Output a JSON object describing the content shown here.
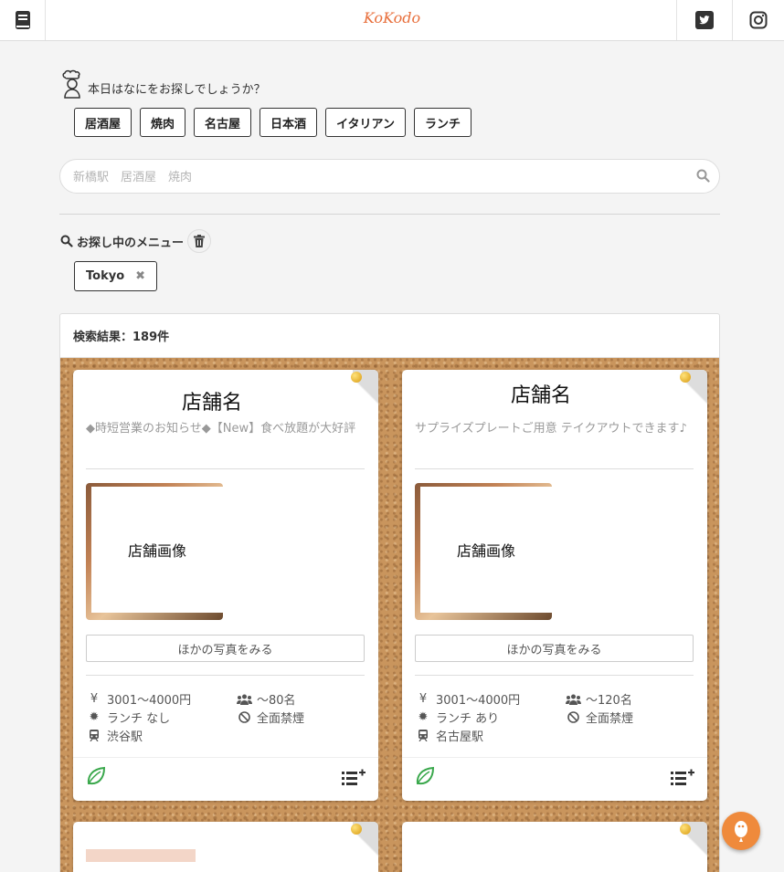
{
  "header": {
    "logo": "KoKodo",
    "menu_icon": "book-icon",
    "twitter_icon": "twitter-icon",
    "instagram_icon": "instagram-icon"
  },
  "prompt": {
    "text": "本日はなにをお探しでしょうか？",
    "icon": "chef-icon"
  },
  "chips": [
    "居酒屋",
    "焼肉",
    "名古屋",
    "日本酒",
    "イタリアン",
    "ランチ"
  ],
  "search": {
    "placeholder": "新橋駅　居酒屋　焼肉",
    "value": ""
  },
  "filter": {
    "title": "お探し中のメニュー",
    "tags": [
      "Tokyo"
    ]
  },
  "results": {
    "label": "検索結果：189件",
    "cards": [
      {
        "name": "店舗名",
        "description": "◆時短営業のお知らせ◆【New】食べ放題が大好評",
        "image_label": "店舗画像",
        "more_photos": "ほかの写真をみる",
        "price": "3001〜4000円",
        "capacity": "〜80名",
        "lunch": "ランチ なし",
        "smoking": "全面禁煙",
        "station": "渋谷駅"
      },
      {
        "name": "店舗名",
        "description": "サプライズプレートご用意 テイクアウトできます♪",
        "image_label": "店舗画像",
        "more_photos": "ほかの写真をみる",
        "price": "3001〜4000円",
        "capacity": "〜120名",
        "lunch": "ランチ あり",
        "smoking": "全面禁煙",
        "station": "名古屋駅"
      }
    ]
  },
  "colors": {
    "brand": "#e8703d",
    "accent_green": "#3aa84c",
    "float_button": "#ef8a3c"
  }
}
